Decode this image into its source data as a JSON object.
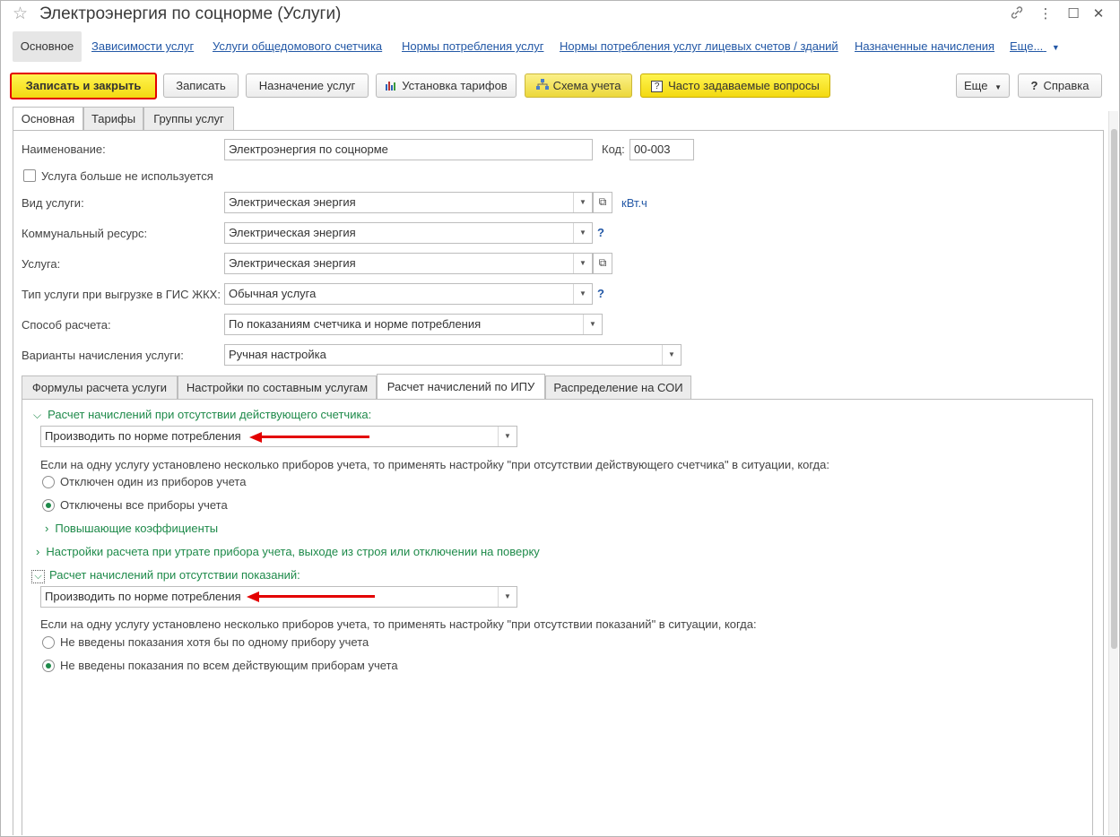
{
  "window": {
    "title": "Электроэнергия по соцнорме (Услуги)"
  },
  "nav": {
    "items": [
      "Основное",
      "Зависимости услуг",
      "Услуги общедомового счетчика",
      "Нормы потребления услуг",
      "Нормы потребления услуг лицевых счетов / зданий",
      "Назначенные начисления",
      "Еще..."
    ]
  },
  "toolbar": {
    "save_close": "Записать и закрыть",
    "save": "Записать",
    "assign": "Назначение услуг",
    "tariffs": "Установка тарифов",
    "scheme": "Схема учета",
    "faq": "Часто задаваемые вопросы",
    "more": "Еще",
    "help": "Справка"
  },
  "tabs": [
    "Основная",
    "Тарифы",
    "Группы услуг"
  ],
  "form": {
    "name_label": "Наименование:",
    "name_value": "Электроэнергия по соцнорме",
    "code_label": "Код:",
    "code_value": "00-003",
    "unused_label": "Услуга больше не используется",
    "kind_label": "Вид услуги:",
    "kind_value": "Электрическая энергия",
    "unit": "кВт.ч",
    "resource_label": "Коммунальный ресурс:",
    "resource_value": "Электрическая энергия",
    "service_label": "Услуга:",
    "service_value": "Электрическая энергия",
    "gis_label": "Тип услуги при выгрузке в ГИС ЖКХ:",
    "gis_value": "Обычная услуга",
    "method_label": "Способ расчета:",
    "method_value": "По показаниям счетчика и норме потребления",
    "variants_label": "Варианты начисления услуги:",
    "variants_value": "Ручная настройка",
    "q": "?"
  },
  "subtabs": [
    "Формулы расчета услуги",
    "Настройки по составным услугам",
    "Расчет начислений по ИПУ",
    "Распределение на СОИ"
  ],
  "ipu": {
    "group1_title": "Расчет начислений при отсутствии действующего счетчика:",
    "group1_value": "Производить по норме потребления",
    "group1_note": "Если на одну услугу установлено несколько приборов учета, то применять настройку \"при отсутствии действующего счетчика\" в ситуации, когда:",
    "group1_opt1": "Отключен один из приборов учета",
    "group1_opt2": "Отключены все приборы учета",
    "coefficients": "Повышающие коэффициенты",
    "loss_settings": "Настройки расчета при утрате прибора учета, выходе из строя или отключении на поверку",
    "group2_title": "Расчет начислений при отсутствии показаний:",
    "group2_value": "Производить по норме потребления",
    "group2_note": "Если на одну услугу установлено несколько приборов учета, то применять настройку \"при отсутствии показаний\" в ситуации, когда:",
    "group2_opt1": "Не введены показания хотя бы по одному прибору учета",
    "group2_opt2": "Не введены показания по всем действующим приборам учета"
  }
}
